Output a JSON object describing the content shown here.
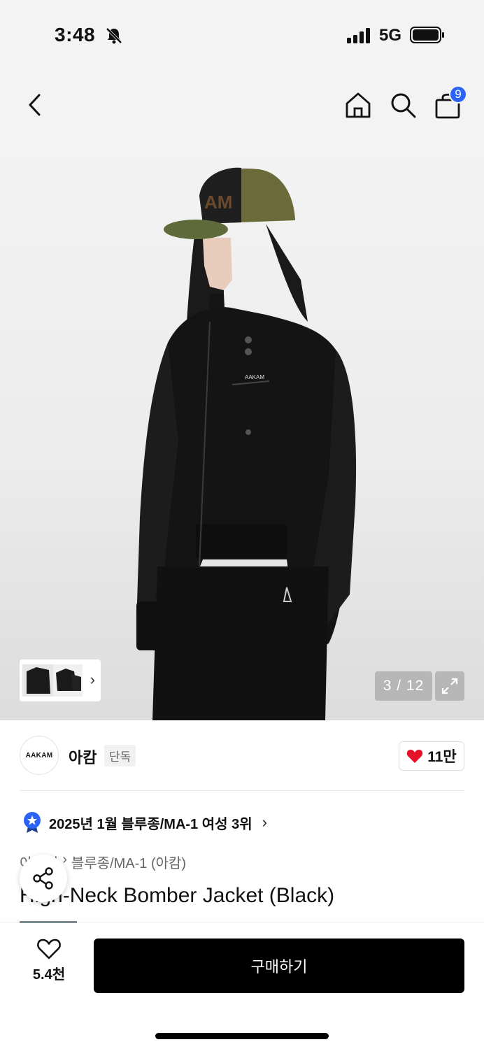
{
  "status_bar": {
    "time": "3:48",
    "network": "5G"
  },
  "nav": {
    "cart_count": "9"
  },
  "gallery": {
    "page_counter": "3 / 12"
  },
  "brand": {
    "logo_text": "AAKAM",
    "name": "아캄",
    "exclusive_tag": "단독",
    "like_count": "11만"
  },
  "ranking": {
    "text": "2025년 1월 블루종/MA-1 여성 3위"
  },
  "breadcrumb": {
    "parent": "아우터",
    "category": "블루종/MA-1 (아캄)"
  },
  "product": {
    "title": "High-Neck Bomber Jacket (Black)"
  },
  "bottom": {
    "wish_count": "5.4천",
    "buy_label": "구매하기"
  },
  "colors": {
    "accent_blue": "#2a63f6",
    "heart_red": "#e5112a",
    "buy_bg": "#000000"
  }
}
